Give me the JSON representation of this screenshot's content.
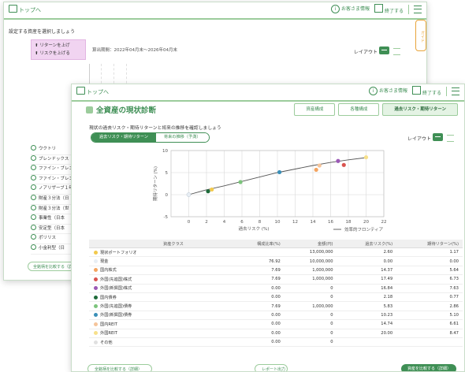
{
  "back_window": {
    "home_label": "トップへ",
    "info_label": "お客さま情報",
    "end_label": "終了する",
    "prompt": "設定する資産を選択しましょう",
    "filter_items": [
      "リターンを上げ",
      "リスクを上げる"
    ],
    "period": "算出期間：2022年04月末～2026年04月末",
    "layout_label": "レイアウト",
    "side_tab": "ガイド",
    "list_items": [
      "ウクトリ",
      "ブレンドックス",
      "ファイン・ブレンド",
      "ファイン・ブレンド",
      "ノアリザーブ１年",
      "財産３分法（日",
      "財産３分法（世",
      "事業性（日本",
      "安定型（日本",
      "ポリリス",
      "小金利型（日"
    ],
    "footer_button": "全銘柄を比較する（詳細）"
  },
  "front_window": {
    "home_label": "トップへ",
    "info_label": "お客さま情報",
    "end_label": "終了する",
    "title": "全資産の現状診断",
    "tabs": [
      {
        "label": "資産構成",
        "active": false
      },
      {
        "label": "各種構成",
        "active": false
      },
      {
        "label": "過去リスク・期待リターン",
        "active": true
      }
    ],
    "subtitle": "現状の過去リスク・期待リターンと将来の推移を確認しましょう",
    "segments": [
      {
        "label": "過去リスク・期待リターン",
        "active": true
      },
      {
        "label": "将来の推移（予測）",
        "active": false
      }
    ],
    "layout_label": "レイアウト",
    "table": {
      "headers": [
        "資産クラス",
        "構成比率(%)",
        "金額(円)",
        "過去リスク(%)",
        "期待リターン(%)"
      ],
      "rows": [
        {
          "name": "現状ポートフォリオ",
          "color": "#f2c94c",
          "cells": [
            "",
            "13,000,000",
            "2.60",
            "1.17"
          ]
        },
        {
          "name": "現金",
          "color": "#e8eef4",
          "cells": [
            "76.92",
            "10,000,000",
            "0.00",
            "0.00"
          ]
        },
        {
          "name": "国内株式",
          "color": "#f4a460",
          "cells": [
            "7.69",
            "1,000,000",
            "14.37",
            "5.64"
          ]
        },
        {
          "name": "外国(先進国)株式",
          "color": "#d9534f",
          "cells": [
            "7.69",
            "1,000,000",
            "17.49",
            "6.73"
          ]
        },
        {
          "name": "外国(新興国)株式",
          "color": "#9b59b6",
          "cells": [
            "0.00",
            "0",
            "16.84",
            "7.63"
          ]
        },
        {
          "name": "国内債券",
          "color": "#1e6b3a",
          "cells": [
            "0.00",
            "0",
            "2.18",
            "0.77"
          ]
        },
        {
          "name": "外国(先進国)債券",
          "color": "#7cc47c",
          "cells": [
            "7.69",
            "1,000,000",
            "5.83",
            "2.86"
          ]
        },
        {
          "name": "外国(新興国)債券",
          "color": "#3a8fb7",
          "cells": [
            "0.00",
            "0",
            "10.23",
            "5.10"
          ]
        },
        {
          "name": "国内REIT",
          "color": "#f5c49a",
          "cells": [
            "0.00",
            "0",
            "14.74",
            "6.61"
          ]
        },
        {
          "name": "外国REIT",
          "color": "#f7e08a",
          "cells": [
            "0.00",
            "0",
            "20.00",
            "8.47"
          ]
        },
        {
          "name": "その他",
          "color": "#e0e0e0",
          "cells": [
            "0.00",
            "0",
            "",
            ""
          ]
        }
      ]
    },
    "footer_buttons": [
      "全銘柄を比較する（詳細）",
      "レポート出力",
      "資産を比較する（詳細）"
    ]
  },
  "chart_data": {
    "type": "scatter",
    "xlabel": "過去リスク (%)",
    "ylabel": "期待リターン (%)",
    "xlim": [
      -2,
      22
    ],
    "ylim": [
      -5,
      10
    ],
    "xticks": [
      0,
      2,
      4,
      6,
      8,
      10,
      12,
      14,
      16,
      18,
      20,
      22
    ],
    "yticks": [
      -5,
      0,
      5,
      10
    ],
    "grid": true,
    "legend": [
      "効率的フロンティア"
    ],
    "legend_position": "bottom-right",
    "frontier": [
      [
        0,
        0
      ],
      [
        2,
        1.1
      ],
      [
        4,
        2.0
      ],
      [
        6,
        3.0
      ],
      [
        8,
        4.0
      ],
      [
        10,
        5.0
      ],
      [
        12,
        5.8
      ],
      [
        14,
        6.6
      ],
      [
        16,
        7.3
      ],
      [
        18,
        7.9
      ],
      [
        20,
        8.4
      ]
    ],
    "points": [
      {
        "name": "現状ポートフォリオ",
        "x": 2.6,
        "y": 1.17,
        "color": "#f2c94c"
      },
      {
        "name": "現金",
        "x": 0.0,
        "y": 0.0,
        "color": "#e8eef4"
      },
      {
        "name": "国内株式",
        "x": 14.37,
        "y": 5.64,
        "color": "#f4a460"
      },
      {
        "name": "外国(先進国)株式",
        "x": 17.49,
        "y": 6.73,
        "color": "#d9534f"
      },
      {
        "name": "外国(新興国)株式",
        "x": 16.84,
        "y": 7.63,
        "color": "#9b59b6"
      },
      {
        "name": "国内債券",
        "x": 2.18,
        "y": 0.77,
        "color": "#1e6b3a"
      },
      {
        "name": "外国(先進国)債券",
        "x": 5.83,
        "y": 2.86,
        "color": "#7cc47c"
      },
      {
        "name": "外国(新興国)債券",
        "x": 10.23,
        "y": 5.1,
        "color": "#3a8fb7"
      },
      {
        "name": "国内REIT",
        "x": 14.74,
        "y": 6.61,
        "color": "#f5c49a"
      },
      {
        "name": "外国REIT",
        "x": 20.0,
        "y": 8.47,
        "color": "#f7e08a"
      }
    ]
  }
}
